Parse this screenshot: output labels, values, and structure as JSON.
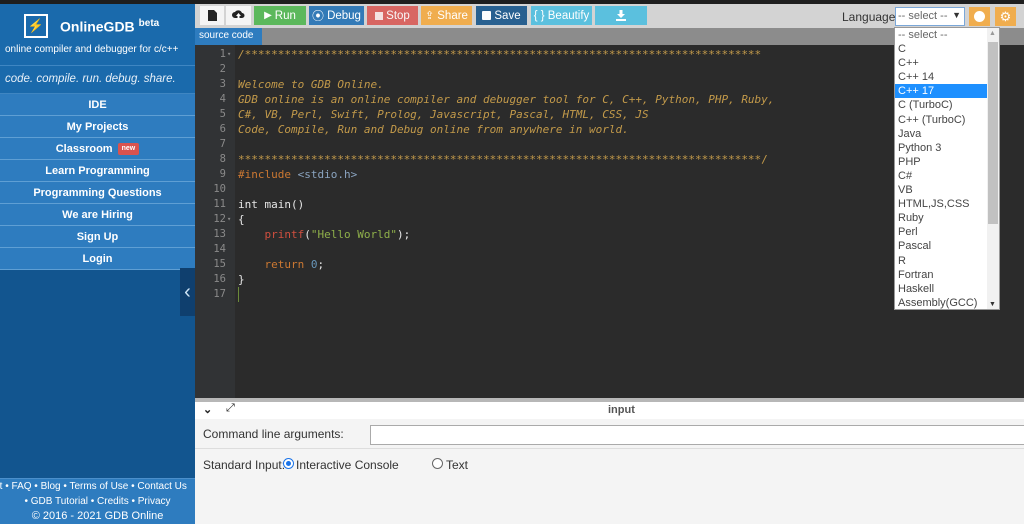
{
  "brand": {
    "name": "OnlineGDB",
    "beta": "beta",
    "subtitle": "online compiler and debugger for c/c++",
    "tagline": "code. compile. run. debug. share.",
    "logo_icon": "lightning-bolt-icon"
  },
  "sidebar": {
    "items": [
      {
        "label": "IDE"
      },
      {
        "label": "My Projects"
      },
      {
        "label": "Classroom",
        "badge": "new"
      },
      {
        "label": "Learn Programming"
      },
      {
        "label": "Programming Questions"
      },
      {
        "label": "We are Hiring"
      },
      {
        "label": "Sign Up"
      },
      {
        "label": "Login"
      }
    ],
    "collapse_icon": "chevron-left-icon",
    "footer": {
      "line1": "ut • FAQ • Blog • Terms of Use • Contact Us",
      "line2": "• GDB Tutorial • Credits • Privacy",
      "line3": "© 2016 - 2021 GDB Online"
    }
  },
  "toolbar": {
    "new_file_icon": "file-icon",
    "upload_icon": "cloud-upload-icon",
    "run": "Run",
    "debug": "Debug",
    "stop": "Stop",
    "share": "Share",
    "save": "Save",
    "beautify": "{ } Beautify",
    "download_icon": "download-icon",
    "language_label": "Language",
    "language_selected": "-- select --",
    "info_icon": "info-icon",
    "settings_icon": "gear-icon"
  },
  "colors": {
    "run": "#5cb85c",
    "debug": "#337ab7",
    "stop": "#d9534f",
    "share": "#f0ad4e",
    "save": "#286090",
    "beautify": "#5bc0de",
    "download": "#5bc0de",
    "sidebar": "#12558f"
  },
  "tabs": [
    {
      "label": "source code"
    }
  ],
  "editor": {
    "line_numbers": [
      "1",
      "2",
      "3",
      "4",
      "5",
      "6",
      "7",
      "8",
      "9",
      "10",
      "11",
      "12",
      "13",
      "14",
      "15",
      "16",
      "17"
    ],
    "lines": {
      "l1": "/******************************************************************************",
      "l3": "Welcome to GDB Online.",
      "l4": "GDB online is an online compiler and debugger tool for C, C++, Python, PHP, Ruby,",
      "l5": "C#, VB, Perl, Swift, Prolog, Javascript, Pascal, HTML, CSS, JS",
      "l6": "Code, Compile, Run and Debug online from anywhere in world.",
      "l8": "*******************************************************************************/",
      "l9_directive": "#include",
      "l9_header": " <stdio.h>",
      "l11": "int main()",
      "l12": "{",
      "l13_indent": "    ",
      "l13_fn": "printf",
      "l13_open": "(",
      "l13_str": "\"Hello World\"",
      "l13_close": ");",
      "l15_indent": "    ",
      "l15_kw": "return",
      "l15_num": " 0",
      "l15_end": ";",
      "l16": "}"
    }
  },
  "language_dropdown": {
    "options": [
      "-- select --",
      "C",
      "C++",
      "C++ 14",
      "C++ 17",
      "C (TurboC)",
      "C++ (TurboC)",
      "Java",
      "Python 3",
      "PHP",
      "C#",
      "VB",
      "HTML,JS,CSS",
      "Ruby",
      "Perl",
      "Pascal",
      "R",
      "Fortran",
      "Haskell",
      "Assembly(GCC)"
    ],
    "highlighted": "C++ 17"
  },
  "input_panel": {
    "title": "input",
    "collapse_icon": "chevron-down-icon",
    "expand_icon": "expand-icon",
    "args_label": "Command line arguments:",
    "args_value": "",
    "stdin_label": "Standard Input:",
    "option_interactive": "Interactive Console",
    "option_text": "Text",
    "selected": "Interactive Console"
  }
}
